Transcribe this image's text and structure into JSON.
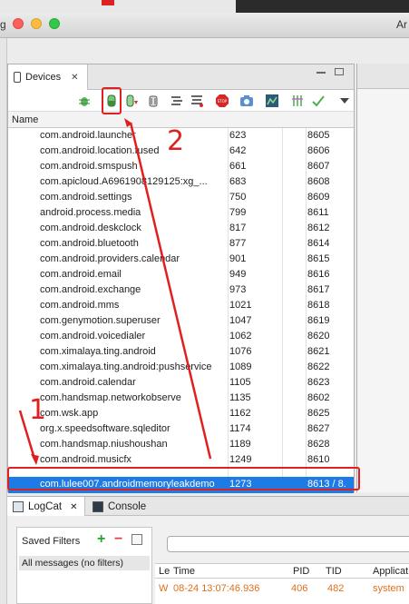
{
  "window": {
    "left_edge_text": "g",
    "title_partial": "Ar"
  },
  "devices_panel": {
    "tab_label": "Devices",
    "column_name": "Name",
    "rows": [
      {
        "name": "com.android.launcher",
        "pid": "623",
        "port": "8605"
      },
      {
        "name": "com.android.location.fused",
        "pid": "642",
        "port": "8606"
      },
      {
        "name": "com.android.smspush",
        "pid": "661",
        "port": "8607"
      },
      {
        "name": "com.apicloud.A6961908129125:xg_...",
        "pid": "683",
        "port": "8608"
      },
      {
        "name": "com.android.settings",
        "pid": "750",
        "port": "8609"
      },
      {
        "name": "android.process.media",
        "pid": "799",
        "port": "8611"
      },
      {
        "name": "com.android.deskclock",
        "pid": "817",
        "port": "8612"
      },
      {
        "name": "com.android.bluetooth",
        "pid": "877",
        "port": "8614"
      },
      {
        "name": "com.android.providers.calendar",
        "pid": "901",
        "port": "8615"
      },
      {
        "name": "com.android.email",
        "pid": "949",
        "port": "8616"
      },
      {
        "name": "com.android.exchange",
        "pid": "973",
        "port": "8617"
      },
      {
        "name": "com.android.mms",
        "pid": "1021",
        "port": "8618"
      },
      {
        "name": "com.genymotion.superuser",
        "pid": "1047",
        "port": "8619"
      },
      {
        "name": "com.android.voicedialer",
        "pid": "1062",
        "port": "8620"
      },
      {
        "name": "com.ximalaya.ting.android",
        "pid": "1076",
        "port": "8621"
      },
      {
        "name": "com.ximalaya.ting.android:pushservice",
        "pid": "1089",
        "port": "8622"
      },
      {
        "name": "com.android.calendar",
        "pid": "1105",
        "port": "8623"
      },
      {
        "name": "com.handsmap.networkobserve",
        "pid": "1135",
        "port": "8602"
      },
      {
        "name": "com.wsk.app",
        "pid": "1162",
        "port": "8625"
      },
      {
        "name": "org.x.speedsoftware.sqleditor",
        "pid": "1174",
        "port": "8627"
      },
      {
        "name": "com.handsmap.niushoushan",
        "pid": "1189",
        "port": "8628"
      },
      {
        "name": "com.android.musicfx",
        "pid": "1249",
        "port": "8610"
      },
      {
        "name": "com.lulee007.androidmemoryleakdemo",
        "pid": "1273",
        "port": "8613 / 8."
      }
    ]
  },
  "bottom_tabs": {
    "logcat": "LogCat",
    "console": "Console"
  },
  "logcat": {
    "saved_filters_title": "Saved Filters",
    "add_symbol": "+",
    "remove_symbol": "−",
    "filter_item": "All messages (no filters)",
    "columns": {
      "level": "Le",
      "time": "Time",
      "pid": "PID",
      "tid": "TID",
      "app": "Applicat"
    },
    "rows": [
      {
        "level": "W",
        "time": "08-24 13:07:46.936",
        "pid": "406",
        "tid": "482",
        "app": "system"
      }
    ]
  },
  "annotations": {
    "label_1": "1",
    "label_2": "2"
  },
  "colors": {
    "selection": "#1c7be4",
    "annotation": "#e02020",
    "warn_log": "#e0701c"
  }
}
